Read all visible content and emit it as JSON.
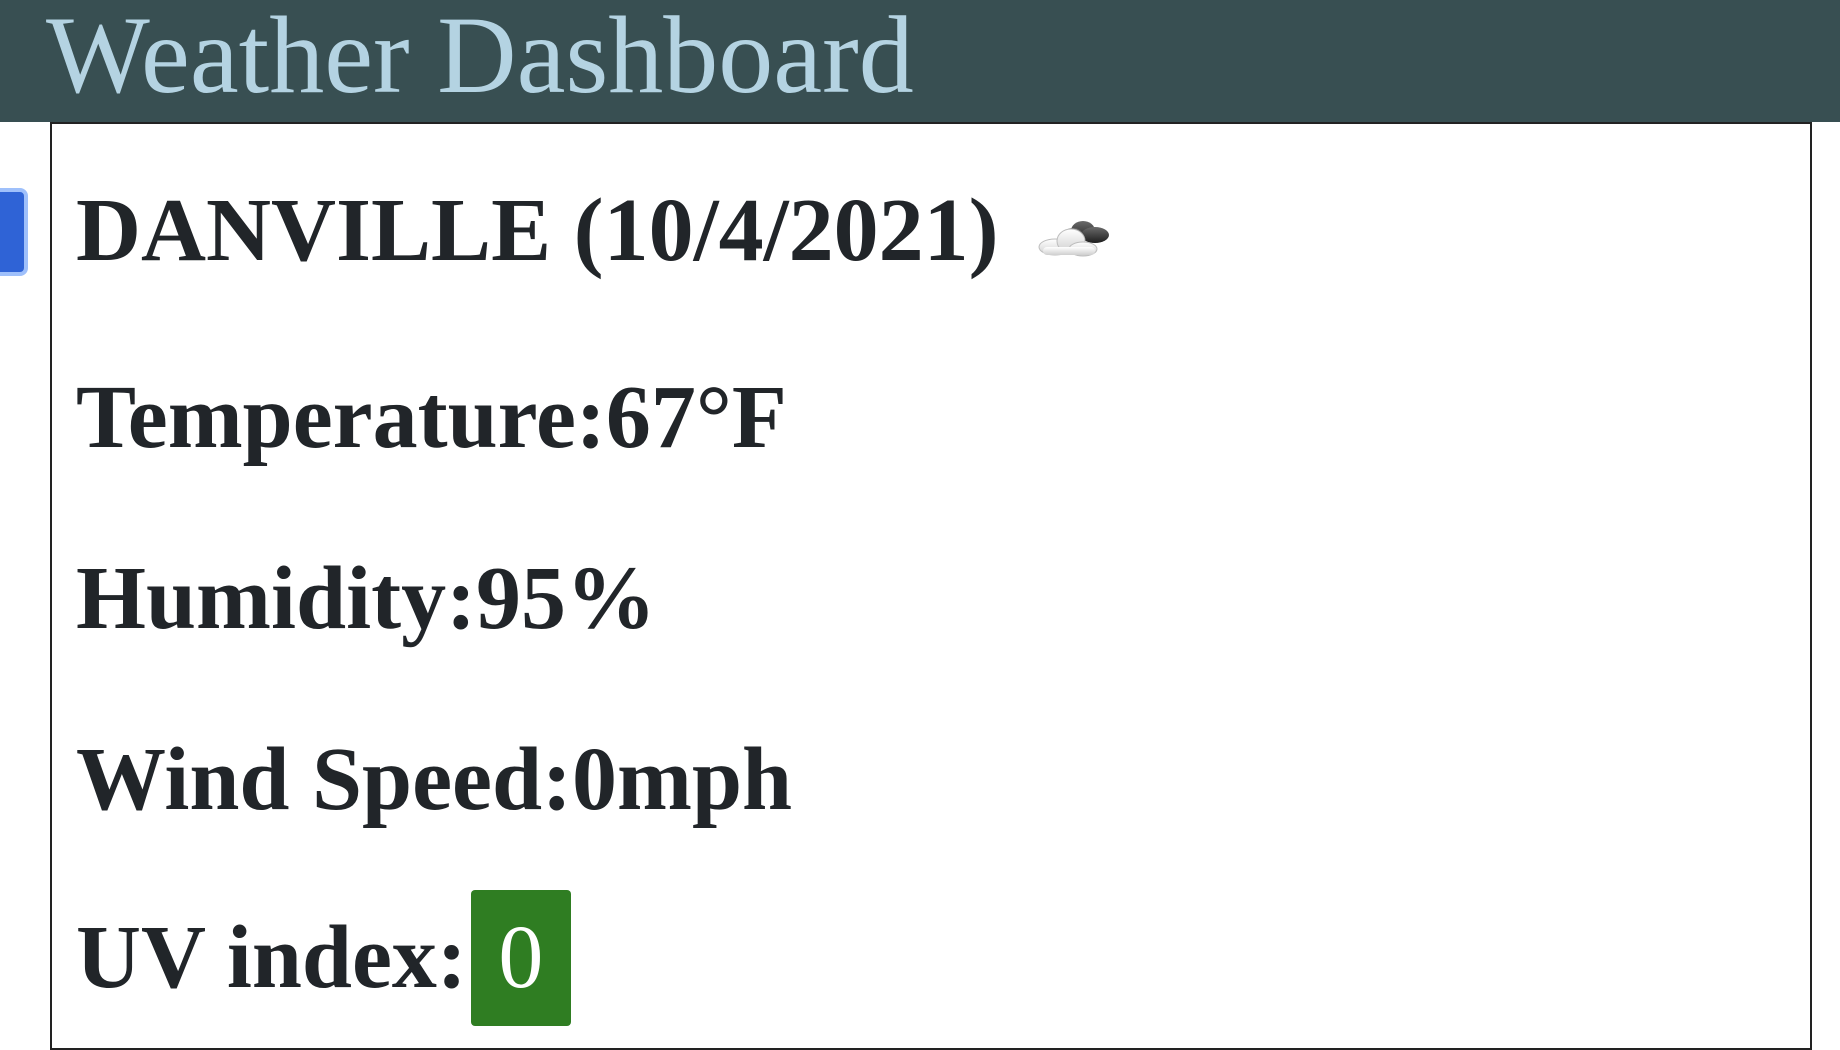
{
  "header": {
    "title": "Weather Dashboard",
    "background_color": "#384f52",
    "title_color": "#b4d3e2"
  },
  "current": {
    "city_date": "DANVILLE (10/4/2021)",
    "icon": "cloud-icon",
    "temperature_label": "Temperature: ",
    "temperature_value": "67°F",
    "humidity_label": "Humidity: ",
    "humidity_value": "95%",
    "wind_label": "Wind Speed: ",
    "wind_value": "0mph",
    "uv_label": "UV index:",
    "uv_value": "0",
    "uv_badge_color": "#2f7d22"
  }
}
